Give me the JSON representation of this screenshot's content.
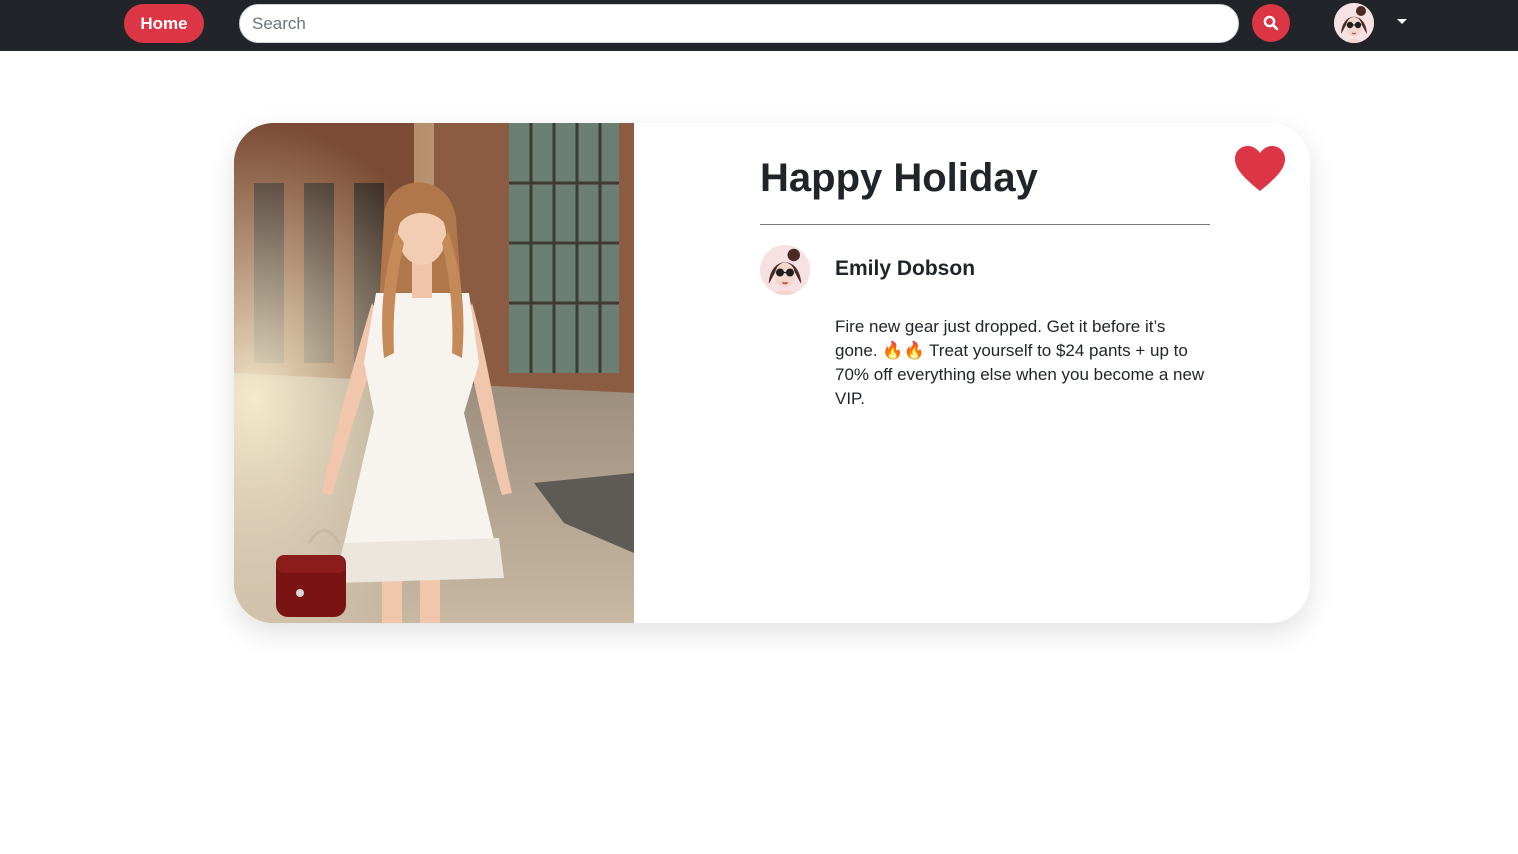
{
  "navbar": {
    "home_label": "Home",
    "search_placeholder": "Search",
    "search_value": "",
    "search_icon": "search-icon",
    "user_avatar": "user-avatar",
    "menu_icon": "caret-down-icon"
  },
  "post": {
    "title": "Happy Holiday",
    "author": "Emily Dobson",
    "text_before_emoji": "Fire new gear just dropped. Get it before it’s gone.",
    "emoji": "🔥🔥",
    "text_after_emoji": "Treat yourself to $24 pants + up to 70% off everything else when you become a new VIP.",
    "photo": "woman-in-white-dress-photo",
    "like_icon": "heart-icon"
  },
  "colors": {
    "navbar": "#212529",
    "accent": "#dc3545",
    "heart": "#dc3545",
    "text": "#212529"
  }
}
